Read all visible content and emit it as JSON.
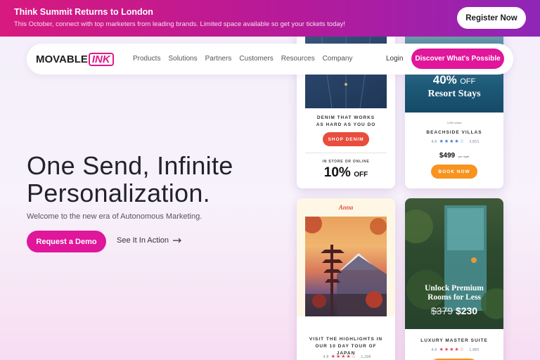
{
  "banner": {
    "title": "Think Summit Returns to London",
    "text": "This October, connect with top marketers from leading brands. Limited space available so get your tickets today!",
    "register_label": "Register Now"
  },
  "nav": {
    "logo_text": "MOVABLE",
    "logo_ink": "INK",
    "links": [
      "Products",
      "Solutions",
      "Partners",
      "Customers",
      "Resources",
      "Company"
    ],
    "login_label": "Login",
    "discover_label": "Discover What's Possible"
  },
  "hero": {
    "title": "One Send, Infinite Personalization.",
    "subtitle": "Welcome to the new era of Autonomous Marketing.",
    "demo_label": "Request a Demo",
    "see_action_label": "See It In Action"
  },
  "cards": {
    "denim": {
      "caption": "DENIM THAT WORKS AS HARD AS YOU DO",
      "button": "SHOP DENIM",
      "store_note": "IN STORE OR ONLINE",
      "discount": "10%",
      "discount_suffix": "OFF"
    },
    "resort": {
      "discount_pct": "40%",
      "discount_off": "OFF",
      "headline": "Resort Stays",
      "small_text": "3,000 views",
      "villa_name": "BEACHSIDE VILLAS",
      "rating": "4.6",
      "reviews": "3,651",
      "price": "$499",
      "price_note": "per night",
      "button": "BOOK NOW"
    },
    "japan": {
      "name": "Anna",
      "caption": "VISIT THE HIGHLIGHTS IN OUR 10 DAY TOUR OF JAPAN",
      "rating": "4.8",
      "reviews": "1,296"
    },
    "suite": {
      "headline": "Unlock Premium Rooms for Less",
      "old_price": "$379",
      "new_price": "$230",
      "suite_name": "LUXURY MASTER SUITE",
      "rating": "4.6",
      "reviews": "1,985"
    }
  },
  "colors": {
    "brand_pink": "#e0169b",
    "banner_start": "#d8197f",
    "banner_end": "#8f26b7",
    "accent_red": "#e84d3d",
    "accent_orange": "#f7931e"
  }
}
